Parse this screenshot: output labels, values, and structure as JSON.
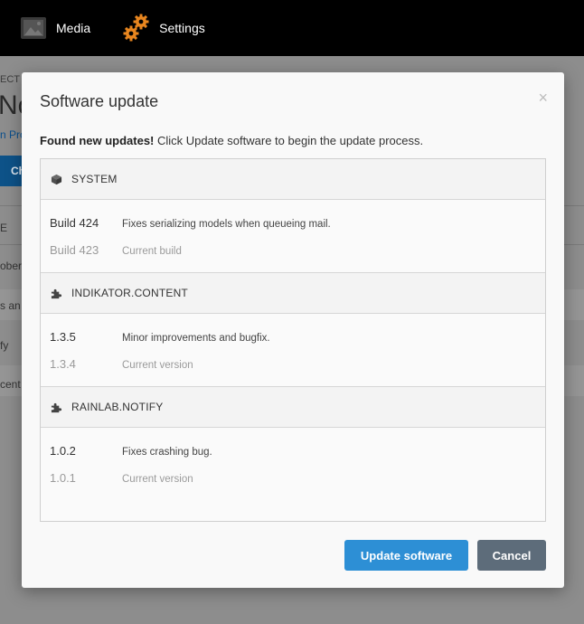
{
  "topbar": {
    "items": [
      {
        "label": "Media",
        "icon": "media-icon"
      },
      {
        "label": "Settings",
        "icon": "gear-icon"
      }
    ]
  },
  "background": {
    "crumb": "ECT",
    "title": "No",
    "link": "n Pro",
    "button": "Ch",
    "column_head": "E",
    "rows": [
      "ober",
      "s an",
      "fy",
      "cent"
    ]
  },
  "modal": {
    "title": "Software update",
    "close_label": "×",
    "intro_bold": "Found new updates!",
    "intro_rest": " Click Update software to begin the update process.",
    "sections": [
      {
        "icon": "cube-icon",
        "name": "SYSTEM",
        "new_version": "Build 424",
        "new_desc": "Fixes serializing models when queueing mail.",
        "old_version": "Build 423",
        "old_desc": "Current build"
      },
      {
        "icon": "puzzle-icon",
        "name": "INDIKATOR.CONTENT",
        "new_version": "1.3.5",
        "new_desc": "Minor improvements and bugfix.",
        "old_version": "1.3.4",
        "old_desc": "Current version"
      },
      {
        "icon": "puzzle-icon",
        "name": "RAINLAB.NOTIFY",
        "new_version": "1.0.2",
        "new_desc": "Fixes crashing bug.",
        "old_version": "1.0.1",
        "old_desc": "Current version"
      }
    ],
    "update_button": "Update software",
    "cancel_button": "Cancel"
  },
  "colors": {
    "primary_button": "#2d8fd5",
    "cancel_button": "#5d6c7a",
    "gear_orange": "#e8861f"
  }
}
